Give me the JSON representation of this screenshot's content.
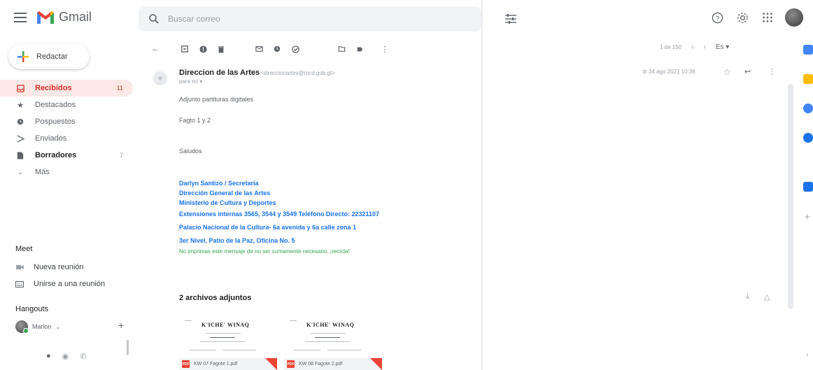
{
  "app": {
    "name": "Gmail"
  },
  "search": {
    "placeholder": "Buscar correo"
  },
  "compose": {
    "label": "Redactar"
  },
  "nav": {
    "items": [
      {
        "label": "Recibidos",
        "count": "11",
        "icon": "inbox-icon",
        "active": true
      },
      {
        "label": "Destacados",
        "count": "",
        "icon": "star-icon"
      },
      {
        "label": "Pospuestos",
        "count": "",
        "icon": "clock-icon"
      },
      {
        "label": "Enviados",
        "count": "",
        "icon": "send-icon"
      },
      {
        "label": "Borradores",
        "count": "7",
        "icon": "draft-icon",
        "bold": true
      },
      {
        "label": "Más",
        "count": "",
        "icon": "chevron-down-icon"
      }
    ]
  },
  "meet": {
    "title": "Meet",
    "new_meeting": "Nueva reunión",
    "join_meeting": "Unirse a una reunión"
  },
  "hangouts": {
    "title": "Hangouts",
    "user": "Marlon"
  },
  "pager": {
    "range": "1 de 150",
    "lang": "Es"
  },
  "message": {
    "sender_name": "Direccion de las Artes",
    "sender_email": "<direccionartes@mcd.gob.gt>",
    "to": "para mí",
    "date": "24 ago 2021 10:36",
    "body": [
      "Adjunto partituras digitales",
      "Fagto 1 y 2",
      "Saludos"
    ],
    "signature": [
      "Darlyn Santizo / Secretaria",
      "Dirección General de las Artes",
      "Ministerio de Cultura y Deportes",
      "Extensiones internas 3565, 3544 y 3549 Teléfono Directo: 22321107",
      "Palacio Nacional de la Cultura- 6a avenida y 6a calle zona 1",
      "3er Nivel, Patio de la Paz, Oficina No. 5"
    ],
    "footer_note": "No imprimas este mensaje de no ser sumamente necesario, ¡recicla!"
  },
  "attachments": {
    "title": "2 archivos adjuntos",
    "files": [
      {
        "name": "KW 07 Fagote 1.pdf",
        "thumb_title": "K'ICHE' WINAQ"
      },
      {
        "name": "KW 08 Fagote 2.pdf",
        "thumb_title": "K'ICHE' WINAQ"
      }
    ]
  },
  "colors": {
    "accent_red": "#d93025",
    "signature_blue": "#1a73e8",
    "eco_green": "#34a853"
  }
}
